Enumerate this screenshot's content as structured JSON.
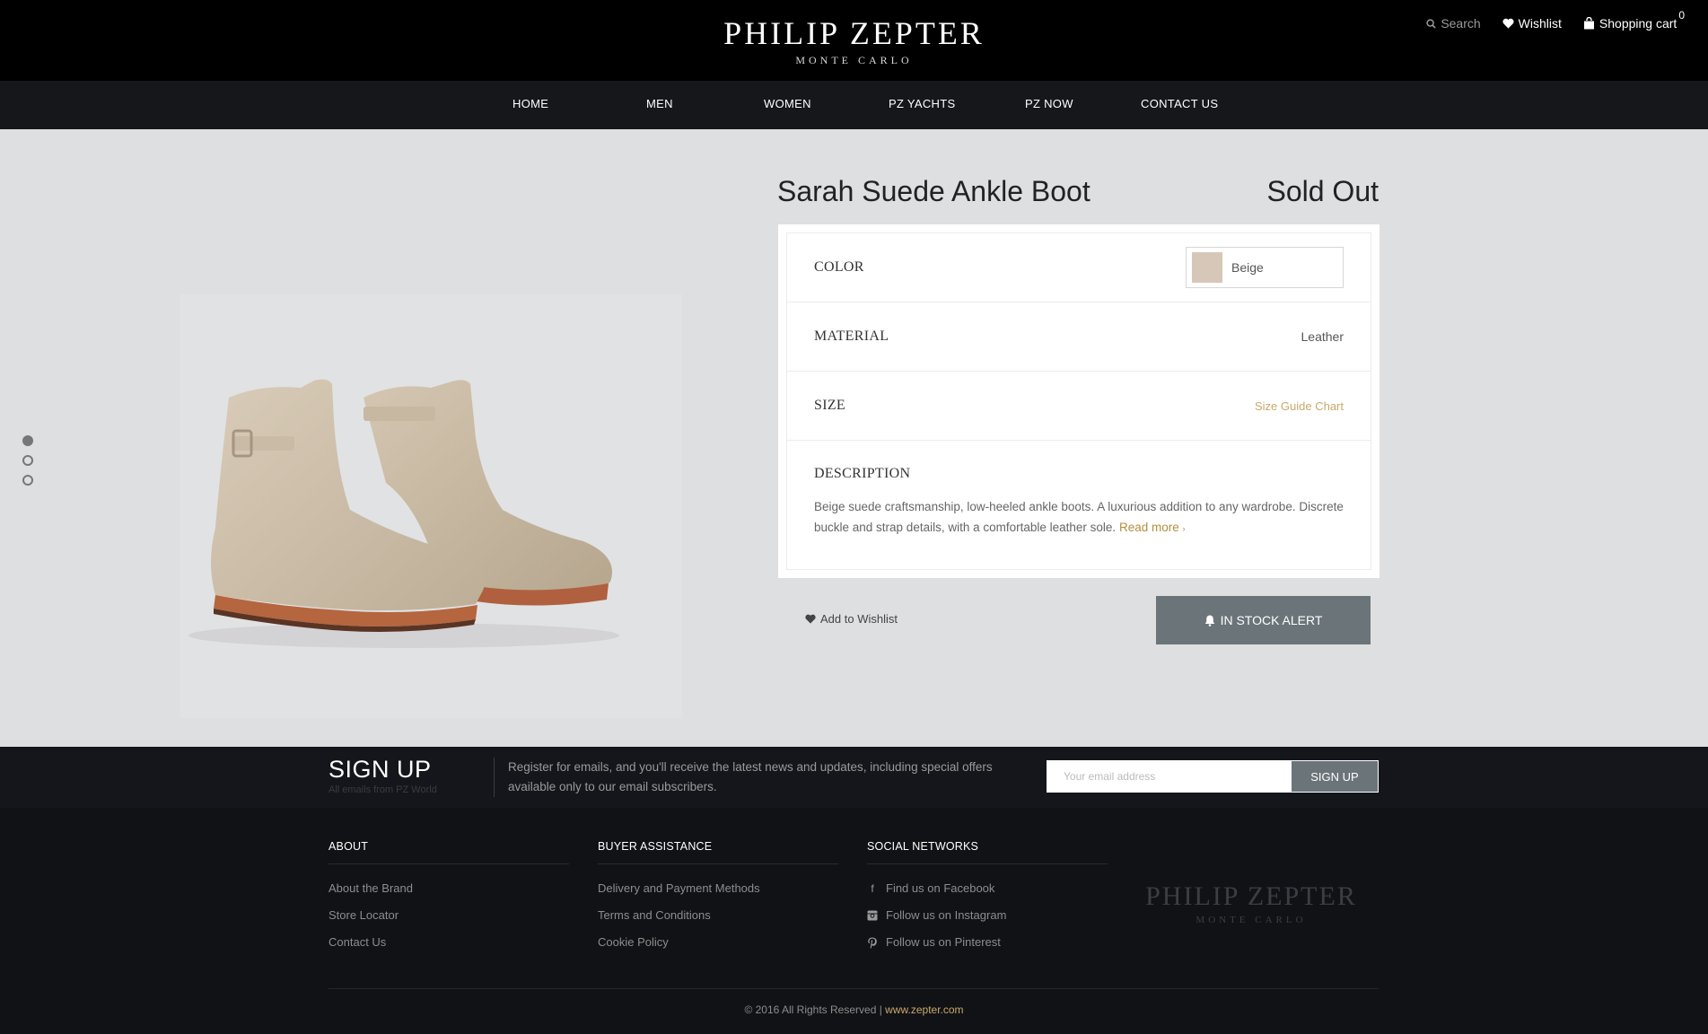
{
  "header": {
    "logo_main": "PHILIP ZEPTER",
    "logo_sub": "MONTE CARLO",
    "search_label": "Search",
    "wishlist_label": "Wishlist",
    "cart_label": "Shopping cart",
    "cart_count": "0"
  },
  "nav": {
    "items": [
      "HOME",
      "MEN",
      "WOMEN",
      "PZ YACHTS",
      "PZ NOW",
      "CONTACT US"
    ]
  },
  "product": {
    "title": "Sarah Suede Ankle Boot",
    "status": "Sold Out",
    "color_label": "COLOR",
    "color_value": "Beige",
    "color_swatch": "#d7c7b8",
    "material_label": "MATERIAL",
    "material_value": "Leather",
    "size_label": "SIZE",
    "size_link": "Size Guide Chart",
    "description_label": "DESCRIPTION",
    "description_text": "Beige suede craftsmanship, low-heeled ankle boots. A luxurious addition to any wardrobe. Discrete buckle and strap details, with a comfortable leather sole.",
    "read_more": "Read more",
    "wishlist_action": "Add to Wishlist",
    "alert_button": "IN STOCK ALERT",
    "gallery_dot_count": 3,
    "gallery_active_index": 0
  },
  "signup": {
    "title": "SIGN UP",
    "subtitle": "All emails from PZ World",
    "copy": "Register for emails, and you'll receive the latest news and updates, including special offers available only to our email subscribers.",
    "email_placeholder": "Your email address",
    "button": "SIGN UP"
  },
  "footer": {
    "about_heading": "ABOUT",
    "about_links": [
      "About the Brand",
      "Store Locator",
      "Contact Us"
    ],
    "buyer_heading": "BUYER ASSISTANCE",
    "buyer_links": [
      "Delivery and Payment Methods",
      "Terms and Conditions",
      "Cookie Policy"
    ],
    "social_heading": "SOCIAL NETWORKS",
    "social_links": [
      "Find us on Facebook",
      "Follow us on Instagram",
      "Follow us on Pinterest"
    ],
    "logo_main": "PHILIP ZEPTER",
    "logo_sub": "MONTE CARLO",
    "copyright": "© 2016 All Rights Reserved |",
    "site_link": "www.zepter.com"
  },
  "colors": {
    "accent_gold": "#c8a96a",
    "button_gray": "#6b7479",
    "header_black": "#000000",
    "nav_dark": "#16171b"
  }
}
